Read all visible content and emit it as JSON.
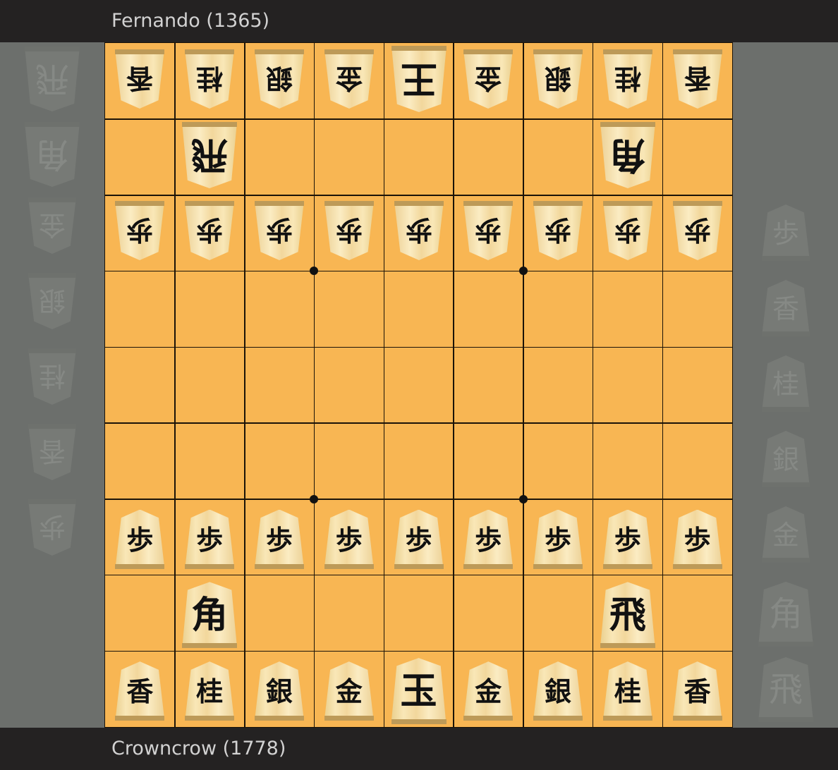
{
  "players": {
    "top": {
      "label": "Fernando (1365)"
    },
    "bottom": {
      "label": "Crowncrow (1778)"
    }
  },
  "board": {
    "files": 9,
    "ranks": 9,
    "star_points": [
      [
        3,
        3
      ],
      [
        3,
        6
      ],
      [
        6,
        3
      ],
      [
        6,
        6
      ]
    ],
    "colors": {
      "board": "#f8b653",
      "lines": "#1b1308",
      "panel": "#6c6f6c",
      "bar": "#242222"
    },
    "pieces": [
      {
        "row": 0,
        "col": 0,
        "glyph": "香",
        "side": "gote",
        "type": "lance"
      },
      {
        "row": 0,
        "col": 1,
        "glyph": "桂",
        "side": "gote",
        "type": "knight"
      },
      {
        "row": 0,
        "col": 2,
        "glyph": "銀",
        "side": "gote",
        "type": "silver"
      },
      {
        "row": 0,
        "col": 3,
        "glyph": "金",
        "side": "gote",
        "type": "gold"
      },
      {
        "row": 0,
        "col": 4,
        "glyph": "王",
        "side": "gote",
        "type": "king"
      },
      {
        "row": 0,
        "col": 5,
        "glyph": "金",
        "side": "gote",
        "type": "gold"
      },
      {
        "row": 0,
        "col": 6,
        "glyph": "銀",
        "side": "gote",
        "type": "silver"
      },
      {
        "row": 0,
        "col": 7,
        "glyph": "桂",
        "side": "gote",
        "type": "knight"
      },
      {
        "row": 0,
        "col": 8,
        "glyph": "香",
        "side": "gote",
        "type": "lance"
      },
      {
        "row": 1,
        "col": 1,
        "glyph": "飛",
        "side": "gote",
        "type": "rook"
      },
      {
        "row": 1,
        "col": 7,
        "glyph": "角",
        "side": "gote",
        "type": "bishop"
      },
      {
        "row": 2,
        "col": 0,
        "glyph": "歩",
        "side": "gote",
        "type": "pawn"
      },
      {
        "row": 2,
        "col": 1,
        "glyph": "歩",
        "side": "gote",
        "type": "pawn"
      },
      {
        "row": 2,
        "col": 2,
        "glyph": "歩",
        "side": "gote",
        "type": "pawn"
      },
      {
        "row": 2,
        "col": 3,
        "glyph": "歩",
        "side": "gote",
        "type": "pawn"
      },
      {
        "row": 2,
        "col": 4,
        "glyph": "歩",
        "side": "gote",
        "type": "pawn"
      },
      {
        "row": 2,
        "col": 5,
        "glyph": "歩",
        "side": "gote",
        "type": "pawn"
      },
      {
        "row": 2,
        "col": 6,
        "glyph": "歩",
        "side": "gote",
        "type": "pawn"
      },
      {
        "row": 2,
        "col": 7,
        "glyph": "歩",
        "side": "gote",
        "type": "pawn"
      },
      {
        "row": 2,
        "col": 8,
        "glyph": "歩",
        "side": "gote",
        "type": "pawn"
      },
      {
        "row": 6,
        "col": 0,
        "glyph": "歩",
        "side": "sente",
        "type": "pawn"
      },
      {
        "row": 6,
        "col": 1,
        "glyph": "歩",
        "side": "sente",
        "type": "pawn"
      },
      {
        "row": 6,
        "col": 2,
        "glyph": "歩",
        "side": "sente",
        "type": "pawn"
      },
      {
        "row": 6,
        "col": 3,
        "glyph": "歩",
        "side": "sente",
        "type": "pawn"
      },
      {
        "row": 6,
        "col": 4,
        "glyph": "歩",
        "side": "sente",
        "type": "pawn"
      },
      {
        "row": 6,
        "col": 5,
        "glyph": "歩",
        "side": "sente",
        "type": "pawn"
      },
      {
        "row": 6,
        "col": 6,
        "glyph": "歩",
        "side": "sente",
        "type": "pawn"
      },
      {
        "row": 6,
        "col": 7,
        "glyph": "歩",
        "side": "sente",
        "type": "pawn"
      },
      {
        "row": 6,
        "col": 8,
        "glyph": "歩",
        "side": "sente",
        "type": "pawn"
      },
      {
        "row": 7,
        "col": 1,
        "glyph": "角",
        "side": "sente",
        "type": "bishop"
      },
      {
        "row": 7,
        "col": 7,
        "glyph": "飛",
        "side": "sente",
        "type": "rook"
      },
      {
        "row": 8,
        "col": 0,
        "glyph": "香",
        "side": "sente",
        "type": "lance"
      },
      {
        "row": 8,
        "col": 1,
        "glyph": "桂",
        "side": "sente",
        "type": "knight"
      },
      {
        "row": 8,
        "col": 2,
        "glyph": "銀",
        "side": "sente",
        "type": "silver"
      },
      {
        "row": 8,
        "col": 3,
        "glyph": "金",
        "side": "sente",
        "type": "gold"
      },
      {
        "row": 8,
        "col": 4,
        "glyph": "玉",
        "side": "sente",
        "type": "king"
      },
      {
        "row": 8,
        "col": 5,
        "glyph": "金",
        "side": "sente",
        "type": "gold"
      },
      {
        "row": 8,
        "col": 6,
        "glyph": "銀",
        "side": "sente",
        "type": "silver"
      },
      {
        "row": 8,
        "col": 7,
        "glyph": "桂",
        "side": "sente",
        "type": "knight"
      },
      {
        "row": 8,
        "col": 8,
        "glyph": "香",
        "side": "sente",
        "type": "lance"
      }
    ]
  },
  "hands": {
    "left": {
      "side": "gote",
      "pieces": [
        {
          "glyph": "飛",
          "type": "rook"
        },
        {
          "glyph": "角",
          "type": "bishop"
        },
        {
          "glyph": "金",
          "type": "gold"
        },
        {
          "glyph": "銀",
          "type": "silver"
        },
        {
          "glyph": "桂",
          "type": "knight"
        },
        {
          "glyph": "香",
          "type": "lance"
        },
        {
          "glyph": "歩",
          "type": "pawn"
        }
      ]
    },
    "right": {
      "side": "sente",
      "pieces": [
        {
          "glyph": "歩",
          "type": "pawn"
        },
        {
          "glyph": "香",
          "type": "lance"
        },
        {
          "glyph": "桂",
          "type": "knight"
        },
        {
          "glyph": "銀",
          "type": "silver"
        },
        {
          "glyph": "金",
          "type": "gold"
        },
        {
          "glyph": "角",
          "type": "bishop"
        },
        {
          "glyph": "飛",
          "type": "rook"
        }
      ]
    }
  }
}
